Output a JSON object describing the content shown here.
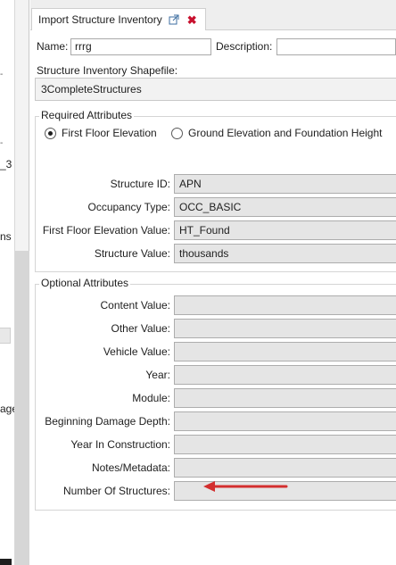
{
  "left_fragments": [
    "_3",
    "ns",
    "age"
  ],
  "tab": {
    "title": "Import Structure Inventory",
    "popout_icon": "popout-icon",
    "close_icon": "close-icon",
    "close_color": "#c8102e"
  },
  "name": {
    "label": "Name:",
    "value": "rrrg"
  },
  "description": {
    "label": "Description:",
    "value": ""
  },
  "shapefile": {
    "label": "Structure Inventory Shapefile:",
    "selected": "3CompleteStructures"
  },
  "required": {
    "title": "Required Attributes",
    "radio_options": [
      {
        "label": "First Floor Elevation",
        "selected": true
      },
      {
        "label": "Ground Elevation and Foundation Height",
        "selected": false
      }
    ],
    "fields": [
      {
        "label": "Structure ID:",
        "value": "APN"
      },
      {
        "label": "Occupancy Type:",
        "value": "OCC_BASIC"
      },
      {
        "label": "First Floor Elevation Value:",
        "value": "HT_Found"
      },
      {
        "label": "Structure Value:",
        "value": "thousands"
      }
    ]
  },
  "optional": {
    "title": "Optional Attributes",
    "fields": [
      {
        "label": "Content Value:",
        "value": ""
      },
      {
        "label": "Other Value:",
        "value": ""
      },
      {
        "label": "Vehicle Value:",
        "value": ""
      },
      {
        "label": "Year:",
        "value": ""
      },
      {
        "label": "Module:",
        "value": ""
      },
      {
        "label": "Beginning Damage Depth:",
        "value": ""
      },
      {
        "label": "Year In Construction:",
        "value": ""
      },
      {
        "label": "Notes/Metadata:",
        "value": ""
      },
      {
        "label": "Number Of Structures:",
        "value": ""
      }
    ]
  },
  "annotation": {
    "arrow_color": "#d32f2f",
    "arrow_icon": "red-arrow-annotation"
  }
}
